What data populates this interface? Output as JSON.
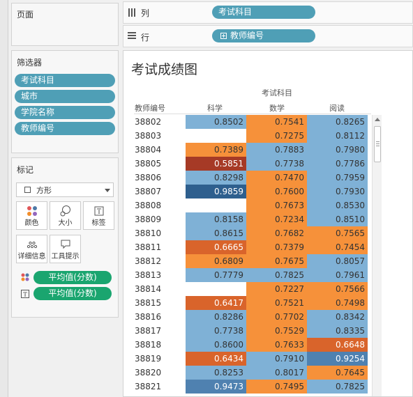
{
  "panels": {
    "pages_title": "页面",
    "filters_title": "筛选器",
    "filters": [
      "考试科目",
      "城市",
      "学院名称",
      "教师编号"
    ],
    "marks_title": "标记",
    "mark_type": "方形",
    "mark_buttons": [
      "颜色",
      "大小",
      "标签",
      "详细信息",
      "工具提示"
    ],
    "mark_fields": [
      "平均值(分数)",
      "平均值(分数)"
    ]
  },
  "shelves": {
    "columns_label": "列",
    "columns_pill": "考试科目",
    "rows_label": "行",
    "rows_pill": "教师编号"
  },
  "view": {
    "title": "考试成绩图",
    "column_group_header": "考试科目",
    "row_header": "教师编号",
    "columns": [
      "科学",
      "数学",
      "阅读"
    ]
  },
  "colors": {
    "orange": "#f6913a",
    "orange_dark": "#d9642b",
    "red_dark": "#a63a26",
    "blue": "#7fb1d6",
    "blue_mid": "#4f81b0",
    "blue_dark": "#2e5f8e"
  },
  "table": {
    "rows": [
      {
        "id": "38802",
        "values": [
          "0.8502",
          "0.7541",
          "0.8265"
        ],
        "colors": [
          "blue",
          "orange",
          "blue"
        ]
      },
      {
        "id": "38803",
        "values": [
          "",
          "0.7275",
          "0.8112"
        ],
        "colors": [
          "",
          "orange",
          "blue"
        ]
      },
      {
        "id": "38804",
        "values": [
          "0.7389",
          "0.7883",
          "0.7980"
        ],
        "colors": [
          "orange",
          "blue",
          "blue"
        ]
      },
      {
        "id": "38805",
        "values": [
          "0.5851",
          "0.7738",
          "0.7786"
        ],
        "colors": [
          "red_dark",
          "blue",
          "blue"
        ]
      },
      {
        "id": "38806",
        "values": [
          "0.8298",
          "0.7470",
          "0.7959"
        ],
        "colors": [
          "blue",
          "orange",
          "blue"
        ]
      },
      {
        "id": "38807",
        "values": [
          "0.9859",
          "0.7600",
          "0.7930"
        ],
        "colors": [
          "blue_dark",
          "orange",
          "blue"
        ]
      },
      {
        "id": "38808",
        "values": [
          "",
          "0.7673",
          "0.8530"
        ],
        "colors": [
          "",
          "orange",
          "blue"
        ]
      },
      {
        "id": "38809",
        "values": [
          "0.8158",
          "0.7234",
          "0.8510"
        ],
        "colors": [
          "blue",
          "orange",
          "blue"
        ]
      },
      {
        "id": "38810",
        "values": [
          "0.8615",
          "0.7682",
          "0.7565"
        ],
        "colors": [
          "blue",
          "orange",
          "orange"
        ]
      },
      {
        "id": "38811",
        "values": [
          "0.6665",
          "0.7379",
          "0.7454"
        ],
        "colors": [
          "orange_dark",
          "orange",
          "orange"
        ]
      },
      {
        "id": "38812",
        "values": [
          "0.6809",
          "0.7675",
          "0.8057"
        ],
        "colors": [
          "orange",
          "orange",
          "blue"
        ]
      },
      {
        "id": "38813",
        "values": [
          "0.7779",
          "0.7825",
          "0.7961"
        ],
        "colors": [
          "blue",
          "blue",
          "blue"
        ]
      },
      {
        "id": "38814",
        "values": [
          "",
          "0.7227",
          "0.7566"
        ],
        "colors": [
          "",
          "orange",
          "orange"
        ]
      },
      {
        "id": "38815",
        "values": [
          "0.6417",
          "0.7521",
          "0.7498"
        ],
        "colors": [
          "orange_dark",
          "orange",
          "orange"
        ]
      },
      {
        "id": "38816",
        "values": [
          "0.8286",
          "0.7702",
          "0.8342"
        ],
        "colors": [
          "blue",
          "orange",
          "blue"
        ]
      },
      {
        "id": "38817",
        "values": [
          "0.7738",
          "0.7529",
          "0.8335"
        ],
        "colors": [
          "blue",
          "orange",
          "blue"
        ]
      },
      {
        "id": "38818",
        "values": [
          "0.8600",
          "0.7633",
          "0.6648"
        ],
        "colors": [
          "blue",
          "orange",
          "orange_dark"
        ]
      },
      {
        "id": "38819",
        "values": [
          "0.6434",
          "0.7910",
          "0.9254"
        ],
        "colors": [
          "orange_dark",
          "blue",
          "blue_mid"
        ]
      },
      {
        "id": "38820",
        "values": [
          "0.8253",
          "0.8017",
          "0.7645"
        ],
        "colors": [
          "blue",
          "blue",
          "orange"
        ]
      },
      {
        "id": "38821",
        "values": [
          "0.9473",
          "0.7495",
          "0.7825"
        ],
        "colors": [
          "blue_mid",
          "orange",
          "blue"
        ]
      }
    ]
  }
}
